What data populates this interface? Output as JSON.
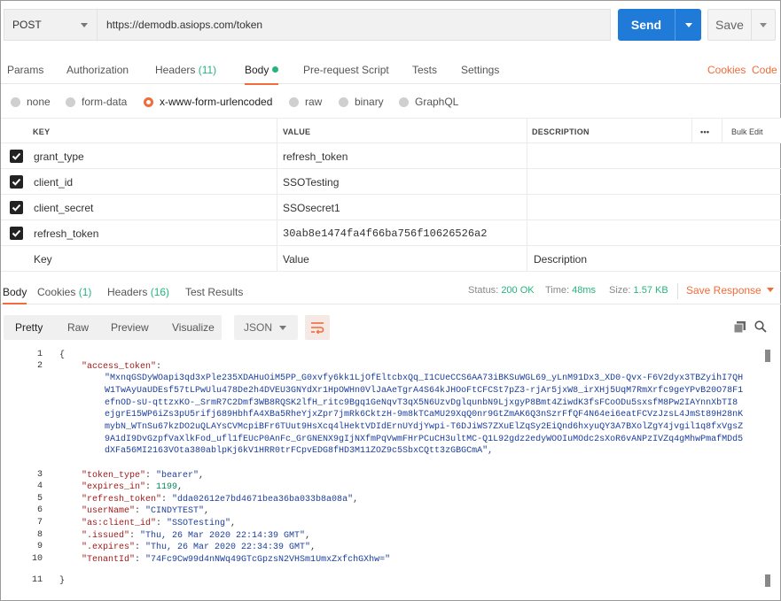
{
  "request": {
    "method": "POST",
    "url": "https://demodb.asiops.com/token",
    "send_label": "Send",
    "save_label": "Save"
  },
  "request_tabs": [
    {
      "label": "Params"
    },
    {
      "label": "Authorization"
    },
    {
      "label": "Headers",
      "count": "(11)"
    },
    {
      "label": "Body",
      "active": true
    },
    {
      "label": "Pre-request Script"
    },
    {
      "label": "Tests"
    },
    {
      "label": "Settings"
    }
  ],
  "links": {
    "cookies": "Cookies",
    "code": "Code"
  },
  "body_types": [
    {
      "label": "none"
    },
    {
      "label": "form-data"
    },
    {
      "label": "x-www-form-urlencoded",
      "selected": true
    },
    {
      "label": "raw"
    },
    {
      "label": "binary"
    },
    {
      "label": "GraphQL"
    }
  ],
  "kv_table": {
    "headers": {
      "key": "KEY",
      "value": "VALUE",
      "description": "DESCRIPTION",
      "more": "•••",
      "bulk_edit": "Bulk Edit"
    },
    "rows": [
      {
        "checked": true,
        "key": "grant_type",
        "value": "refresh_token"
      },
      {
        "checked": true,
        "key": "client_id",
        "value": "SSOTesting"
      },
      {
        "checked": true,
        "key": "client_secret",
        "value": "SSOsecret1"
      },
      {
        "checked": true,
        "key": "refresh_token",
        "value": "30ab8e1474fa4f66ba756f10626526a2"
      }
    ],
    "placeholders": {
      "key": "Key",
      "value": "Value",
      "description": "Description"
    }
  },
  "response_tabs": [
    {
      "label": "Body",
      "active": true
    },
    {
      "label": "Cookies",
      "count": "(1)"
    },
    {
      "label": "Headers",
      "count": "(16)"
    },
    {
      "label": "Test Results"
    }
  ],
  "status": {
    "status_label": "Status:",
    "status_value": "200 OK",
    "time_label": "Time:",
    "time_value": "48ms",
    "size_label": "Size:",
    "size_value": "1.57 KB",
    "save_response": "Save Response"
  },
  "view_tabs": [
    {
      "label": "Pretty",
      "active": true
    },
    {
      "label": "Raw"
    },
    {
      "label": "Preview"
    },
    {
      "label": "Visualize"
    }
  ],
  "format": "JSON",
  "icons": {
    "wrap": "wrap-lines-icon",
    "copy": "copy-icon",
    "search": "search-icon"
  },
  "response_json": {
    "open_brace": "{",
    "close_brace": "}",
    "line_numbers": [
      "1",
      "2",
      "3",
      "4",
      "5",
      "6",
      "7",
      "8",
      "9",
      "10",
      "11"
    ],
    "access_token_key": "\"access_token\"",
    "access_token_lines": [
      "\"MxnqGSDyWOapi3qd3xPle235XDAHuOiM5PP_G0xvfy6kk1LjOfEltcbxQq_I1CUeCCS6AA73iBKSuWGL69_yLnM91Dx3_XD0-Qvx-F6V2dyx3TBZyihI7QH",
      "W1TwAyUaUDEsf57tLPwUlu478De2h4DVEU3GNYdXr1HpOWHn0VlJaAeTgrA4S64kJHOoFtCFCSt7pZ3-rjAr5jxW8_irXHj5UqM7RmXrfc9geYPvB20O78F1",
      "efnOD-sU-qttzxKO-_SrmR7C2Dmf3WB8RQSK2lfH_ritc9Bgq1GeNqvT3qX5N6UzvDglqunbN9LjxgyP8Bmt4ZiwdK3fsFCoODu5sxsfM8Pw2IAYnnXbTI8",
      "ejgrE15WP6iZs3pU5rifj689HbhfA4XBa5RheYjxZpr7jmRk6CktzH-9m8kTCaMU29XqQ0nr9GtZmAK6Q3nSzrFfQF4N64ei6eatFCVzJzsL4JmSt89H28nK",
      "mybN_WTnSu67kzDO2uQLAYsCVMcpiBFr6TUut9HsXcq4lHektVDIdErnUYdjYwpi-T6DJiWS7ZXuElZqSy2EiQnd6hxyuQY3A7BXolZgY4jvgil1q8fxVgsZ",
      "9A1dI9DvGzpfVaXlkFod_ufl1fEUcP0AnFc_GrGNENX9gIjNXfmPqVwmFHrPCuCH3ultMC-Q1L92gdz2edyWOOIuMOdc2sXoR6vANPzIVZq4gMhwPmafMDd5",
      "dXFa56MI2163VOta380ablpKj6kV1HRR0trFCpvEDG8fHD3M11ZOZ9c5SbxCQtt3zGBGCmA\","
    ],
    "pairs": [
      {
        "key": "\"token_type\"",
        "value": "\"bearer\"",
        "kind": "str"
      },
      {
        "key": "\"expires_in\"",
        "value": "1199",
        "kind": "num"
      },
      {
        "key": "\"refresh_token\"",
        "value": "\"dda02612e7bd4671bea36ba033b8a08a\"",
        "kind": "str"
      },
      {
        "key": "\"userName\"",
        "value": "\"CINDYTEST\"",
        "kind": "str"
      },
      {
        "key": "\"as:client_id\"",
        "value": "\"SSOTesting\"",
        "kind": "str"
      },
      {
        "key": "\".issued\"",
        "value": "\"Thu, 26 Mar 2020 22:14:39 GMT\"",
        "kind": "str"
      },
      {
        "key": "\".expires\"",
        "value": "\"Thu, 26 Mar 2020 22:34:39 GMT\"",
        "kind": "str"
      },
      {
        "key": "\"TenantId\"",
        "value": "\"74Fc9Cw99d4nNWq49GTcGpzsN2VHSm1UmxZxfchGXhw=\"",
        "kind": "str",
        "last": true
      }
    ]
  }
}
